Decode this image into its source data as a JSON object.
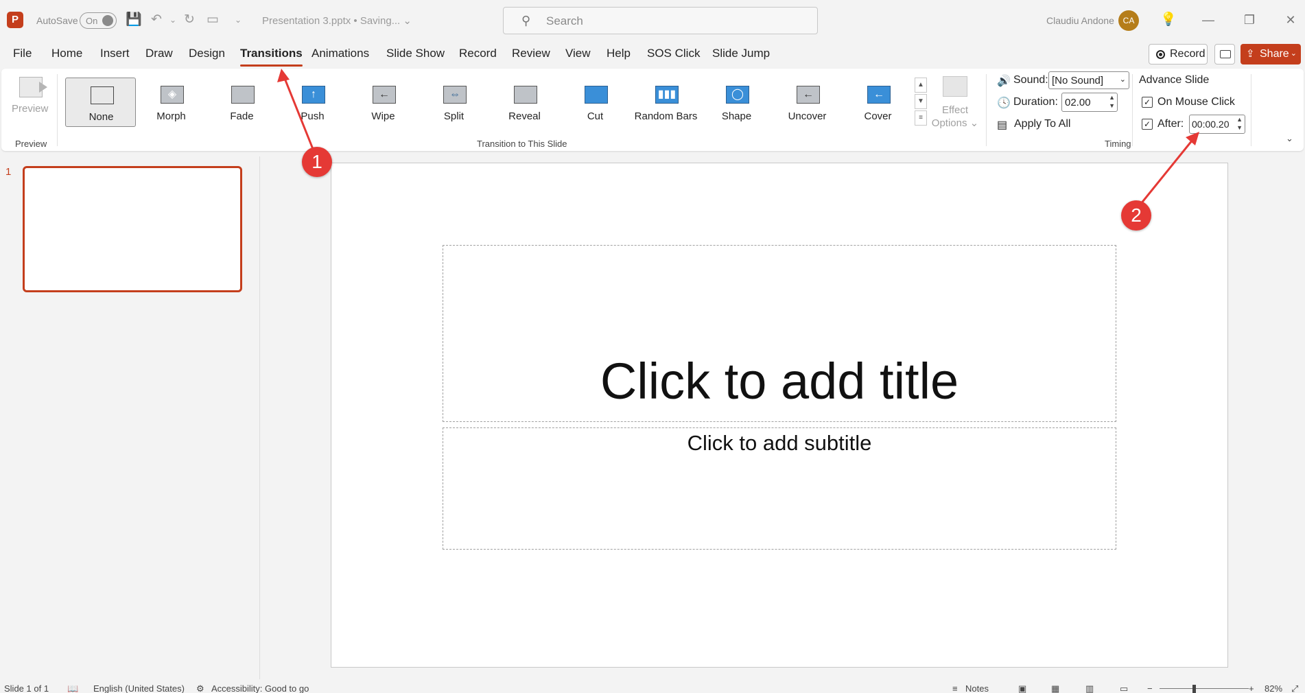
{
  "app": {
    "logo_letter": "P"
  },
  "titlebar": {
    "autosave_label": "AutoSave",
    "autosave_state": "On",
    "document_title": "Presentation 3.pptx • Saving... ⌄",
    "search_placeholder": "Search",
    "user_name": "Claudiu Andone",
    "user_initials": "CA"
  },
  "menu": {
    "tabs": [
      "File",
      "Home",
      "Insert",
      "Draw",
      "Design",
      "Transitions",
      "Animations",
      "Slide Show",
      "Record",
      "Review",
      "View",
      "Help",
      "SOS Click",
      "Slide Jump"
    ],
    "active_tab": "Transitions",
    "record_label": "Record",
    "share_label": "Share"
  },
  "ribbon": {
    "preview_label": "Preview",
    "preview_group": "Preview",
    "transitions": [
      "None",
      "Morph",
      "Fade",
      "Push",
      "Wipe",
      "Split",
      "Reveal",
      "Cut",
      "Random Bars",
      "Shape",
      "Uncover",
      "Cover"
    ],
    "selected_transition": "None",
    "effect_options_line1": "Effect",
    "effect_options_line2": "Options ⌄",
    "transition_group": "Transition to This Slide",
    "sound_label": "Sound:",
    "sound_value": "[No Sound]",
    "duration_label": "Duration:",
    "duration_value": "02.00",
    "apply_all_label": "Apply To All",
    "advance_title": "Advance Slide",
    "on_mouse_click_label": "On Mouse Click",
    "on_mouse_click_checked": true,
    "after_label": "After:",
    "after_checked": true,
    "after_value": "00:00.20",
    "timing_group": "Timing"
  },
  "slides_panel": {
    "slide_number": "1"
  },
  "slide": {
    "title_placeholder": "Click to add title",
    "subtitle_placeholder": "Click to add subtitle"
  },
  "annotations": {
    "badge1": "1",
    "badge2": "2",
    "color": "#e53935"
  },
  "statusbar": {
    "slide_info": "Slide 1 of 1",
    "language": "English (United States)",
    "accessibility": "Accessibility: Good to go",
    "notes_label": "Notes",
    "zoom": "82%"
  },
  "colors": {
    "accent": "#c43e1c"
  }
}
